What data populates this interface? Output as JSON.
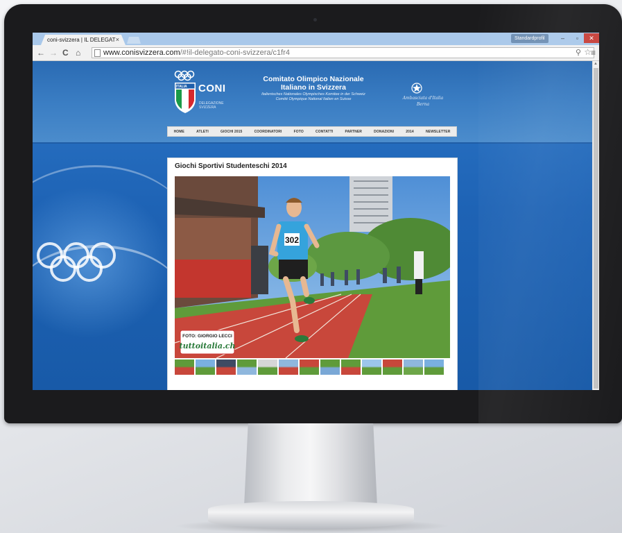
{
  "browser": {
    "tab_title": "coni-svizzera | IL DELEGAT",
    "tab_close": "×",
    "profile_label": "Standardprofil",
    "win_minimize": "–",
    "win_maximize": "▫",
    "win_close": "✕",
    "nav_back": "←",
    "nav_forward": "→",
    "nav_reload": "C",
    "nav_home": "⌂",
    "url_domain": "www.conisvizzera.com",
    "url_path": "/#!il-delegato-coni-svizzera/c1fr4",
    "zoom_icon": "⚲",
    "bookmark_star": "☆",
    "menu_icon": "≡"
  },
  "header": {
    "logo_flag_label": "ITALIA",
    "logo_text": "CONI",
    "logo_sub": [
      "DELEGAZIONE",
      "SVIZZERA"
    ],
    "title_line1": "Comitato Olimpico Nazionale",
    "title_line2": "Italiano in Svizzera",
    "title_line3": "Italienisches Nationales Olympisches Komitee in der Schweiz",
    "title_line4": "Comité Olympique National Italien en Suisse",
    "embassy_line1": "Ambasciata d'Italia",
    "embassy_line2": "Berna"
  },
  "menu": [
    "HOME",
    "ATLETI",
    "GIOCHI 2015",
    "COORDINATORI",
    "FOTO",
    "CONTATTI",
    "PARTNER",
    "DONAZIONI",
    "2014",
    "NEWSLETTER"
  ],
  "content": {
    "heading": "Giochi Sportivi Studenteschi 2014",
    "bib_number": "302",
    "photo_credit": "FOTO: GIORGIO LECCI",
    "photo_watermark": "tuttoitalia.ch",
    "thumbnail_count": 13
  },
  "colors": {
    "page_blue": "#1e63b5",
    "header_blue": "#3a7dc3",
    "track_red": "#c8473b",
    "grass_green": "#5f9b3a"
  }
}
